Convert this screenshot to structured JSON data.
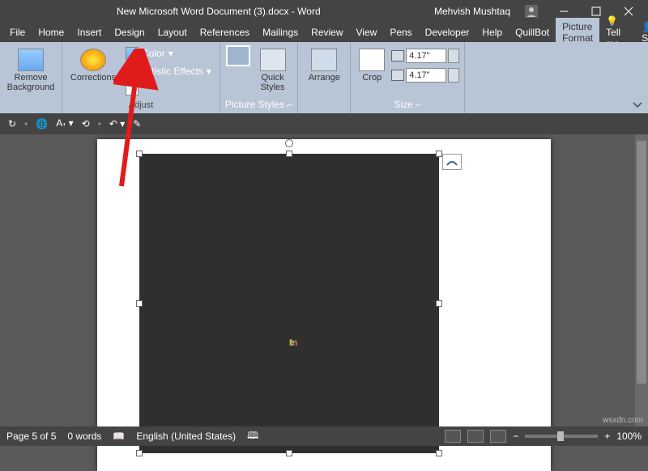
{
  "title": "New Microsoft Word Document (3).docx - Word",
  "user": "Mehvish Mushtaq",
  "menu": {
    "file": "File",
    "home": "Home",
    "insert": "Insert",
    "design": "Design",
    "layout": "Layout",
    "references": "References",
    "mailings": "Mailings",
    "review": "Review",
    "view": "View",
    "pens": "Pens",
    "developer": "Developer",
    "help": "Help",
    "quillbot": "QuillBot",
    "pictureformat": "Picture Format",
    "tellme": "Tell me",
    "share": "Share"
  },
  "ribbon": {
    "removebg": "Remove\nBackground",
    "corrections": "Corrections",
    "color": "Color",
    "artistic": "Artistic Effects",
    "adjust": "Adjust",
    "quickstyles": "Quick\nStyles",
    "picstyles": "Picture Styles",
    "arrange": "Arrange",
    "crop": "Crop",
    "size": "Size",
    "width": "4.17\"",
    "height": "4.17\""
  },
  "status": {
    "page": "Page 5 of 5",
    "words": "0 words",
    "lang": "English (United States)",
    "zoom": "100%"
  },
  "logo": {
    "m": "m",
    "t": "t",
    "e": "e"
  },
  "watermark": "wsxdn.com"
}
